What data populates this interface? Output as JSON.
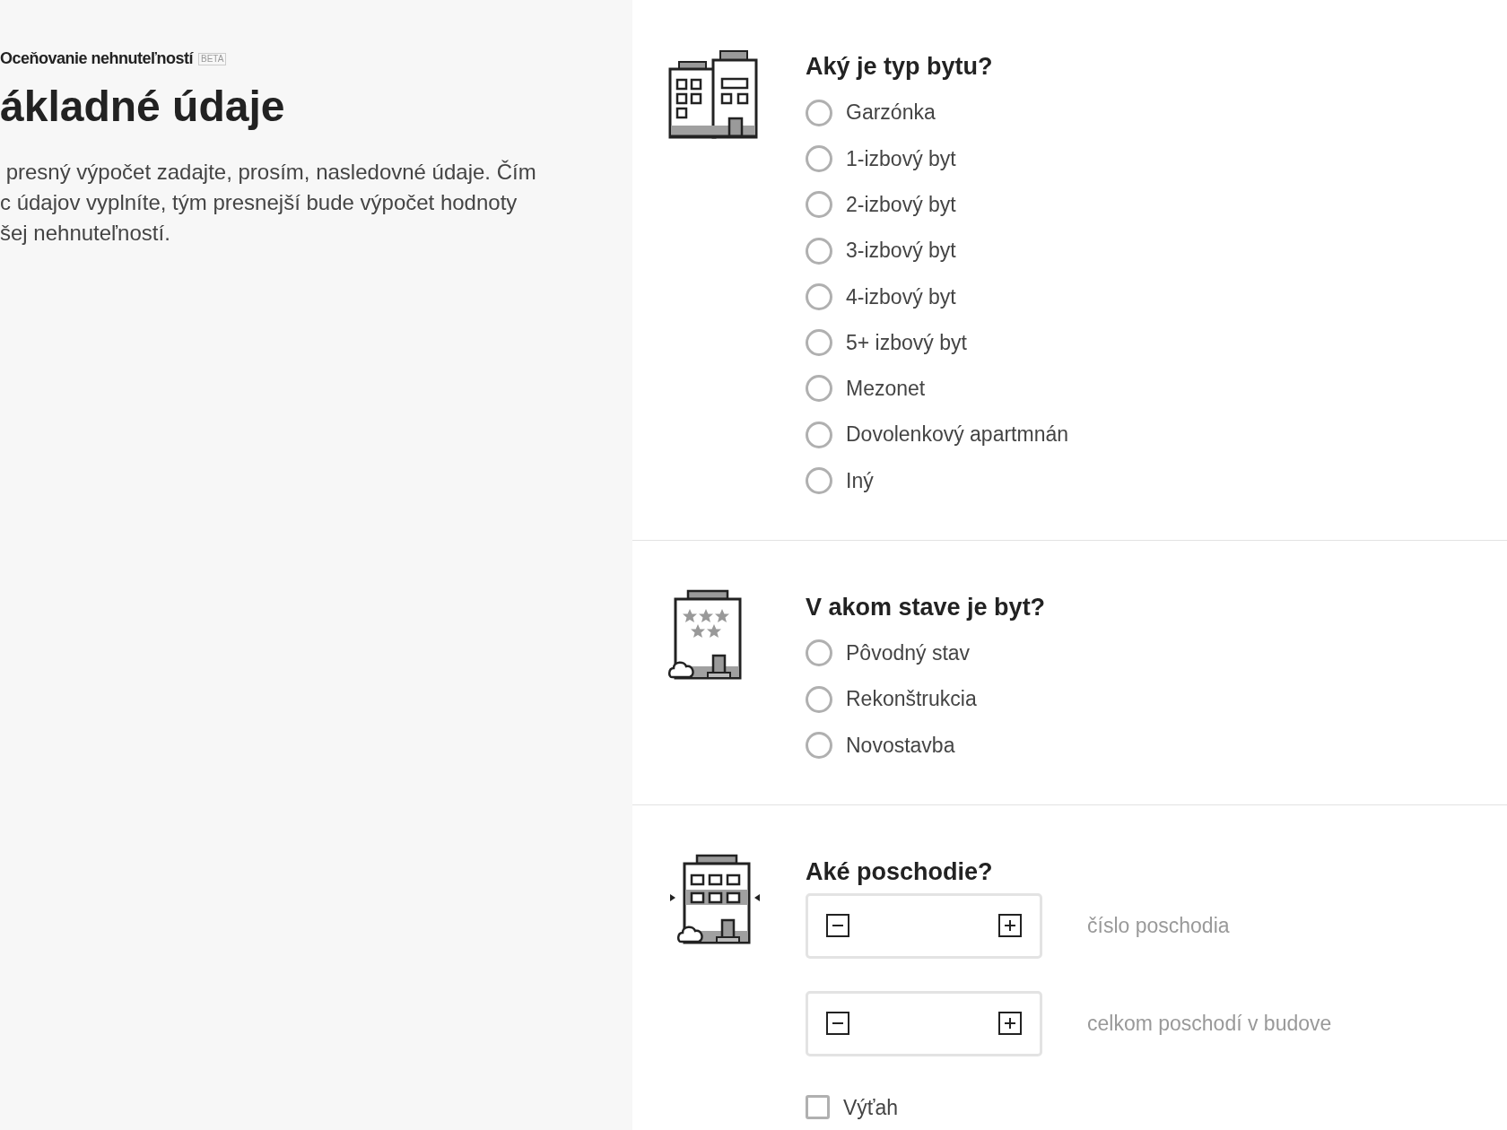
{
  "intro": {
    "brand": "Oceňovanie nehnuteľností",
    "badge": "BETA",
    "heading": "ákladné údaje",
    "paragraph_lines": [
      " presný výpočet zadajte, prosím, nasledovné údaje. Čím",
      "c údajov vyplníte, tým presnejší bude výpočet hodnoty",
      "šej nehnuteľností."
    ]
  },
  "sections": [
    {
      "kind": "radio",
      "question": "Aký je typ bytu?",
      "options": [
        {
          "label": "Garzónka",
          "selected": false
        },
        {
          "label": "1-izbový byt",
          "selected": false
        },
        {
          "label": "2-izbový byt",
          "selected": false
        },
        {
          "label": "3-izbový byt",
          "selected": false
        },
        {
          "label": "4-izbový byt",
          "selected": false
        },
        {
          "label": "5+ izbový byt",
          "selected": false
        },
        {
          "label": "Mezonet",
          "selected": false
        },
        {
          "label": "Dovolenkový apartmnán",
          "selected": false
        },
        {
          "label": "Iný",
          "selected": false
        }
      ]
    },
    {
      "kind": "radio",
      "question": "V akom stave je byt?",
      "options": [
        {
          "label": "Pôvodný stav",
          "selected": false
        },
        {
          "label": "Rekonštrukcia",
          "selected": false
        },
        {
          "label": "Novostavba",
          "selected": false
        }
      ]
    },
    {
      "kind": "floor",
      "question": "Aké poschodie?",
      "steppers": [
        {
          "label": "číslo poschodia"
        },
        {
          "label": "celkom poschodí v budove"
        }
      ],
      "checkbox": {
        "label": "Výťah",
        "checked": false
      }
    }
  ]
}
